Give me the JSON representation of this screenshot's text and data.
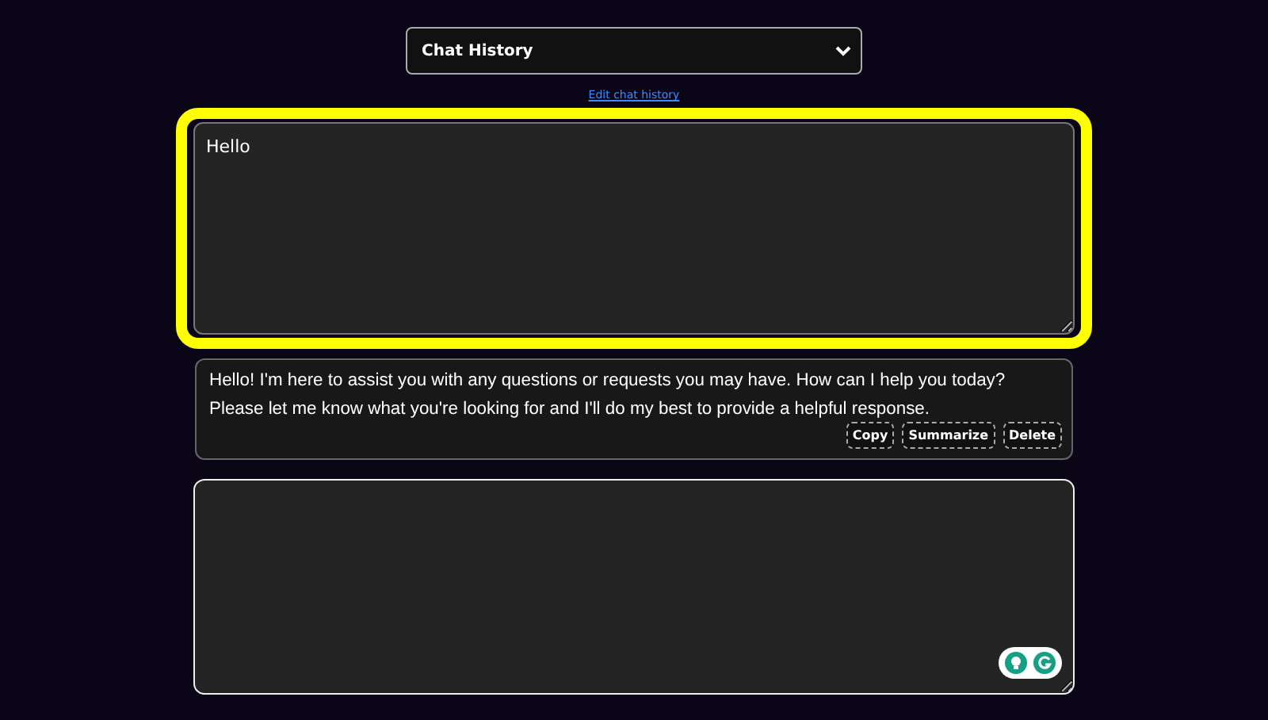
{
  "history_select": {
    "value": "Chat History"
  },
  "edit_link": "Edit chat history",
  "prompt": {
    "value": "Hello",
    "highlighted": true
  },
  "response": {
    "text": "Hello! I'm here to assist you with any questions or requests you may have. How can I help you today? Please let me know what you're looking for and I'll do my best to provide a helpful response.",
    "buttons": [
      "Copy",
      "Summarize",
      "Delete"
    ]
  }
}
